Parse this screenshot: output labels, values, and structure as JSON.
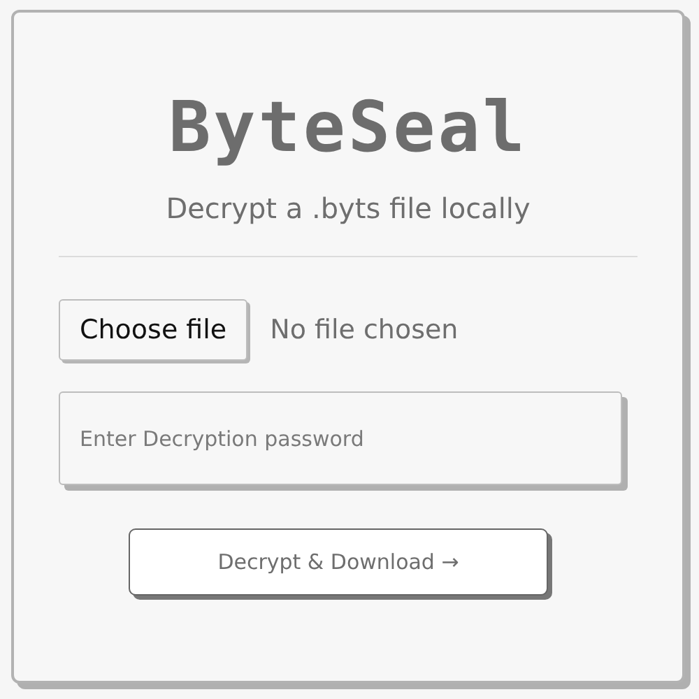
{
  "title": "ByteSeal",
  "subtitle": "Decrypt a .byts file locally",
  "file_picker": {
    "button": "Choose file",
    "status": "No file chosen"
  },
  "password": {
    "placeholder": "Enter Decryption password"
  },
  "submit": {
    "label": "Decrypt & Download →"
  }
}
